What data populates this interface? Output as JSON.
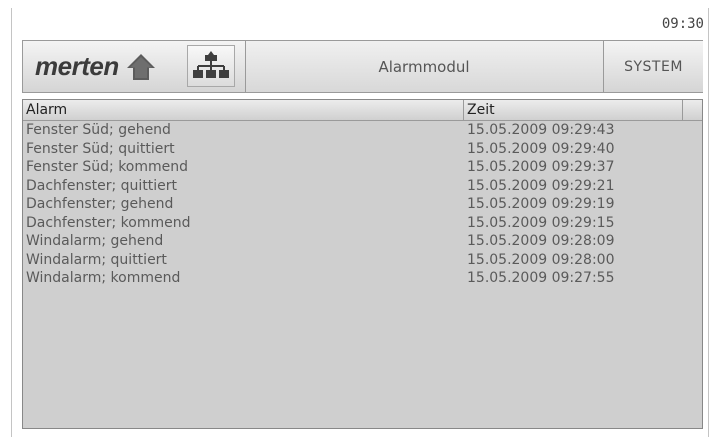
{
  "clock": "09:30",
  "toolbar": {
    "logo": "merten",
    "title": "Alarmmodul",
    "system_label": "SYSTEM"
  },
  "table": {
    "headers": {
      "alarm": "Alarm",
      "zeit": "Zeit"
    },
    "rows": [
      {
        "alarm": "Fenster Süd; gehend",
        "zeit": "15.05.2009 09:29:43"
      },
      {
        "alarm": "Fenster Süd; quittiert",
        "zeit": "15.05.2009 09:29:40"
      },
      {
        "alarm": "Fenster Süd; kommend",
        "zeit": "15.05.2009 09:29:37"
      },
      {
        "alarm": "Dachfenster; quittiert",
        "zeit": "15.05.2009 09:29:21"
      },
      {
        "alarm": "Dachfenster; gehend",
        "zeit": "15.05.2009 09:29:19"
      },
      {
        "alarm": "Dachfenster; kommend",
        "zeit": "15.05.2009 09:29:15"
      },
      {
        "alarm": "Windalarm; gehend",
        "zeit": "15.05.2009 09:28:09"
      },
      {
        "alarm": "Windalarm; quittiert",
        "zeit": "15.05.2009 09:28:00"
      },
      {
        "alarm": "Windalarm; kommend",
        "zeit": "15.05.2009 09:27:55"
      }
    ]
  },
  "icons": {
    "home": "home-icon",
    "tree": "hierarchy-icon"
  }
}
